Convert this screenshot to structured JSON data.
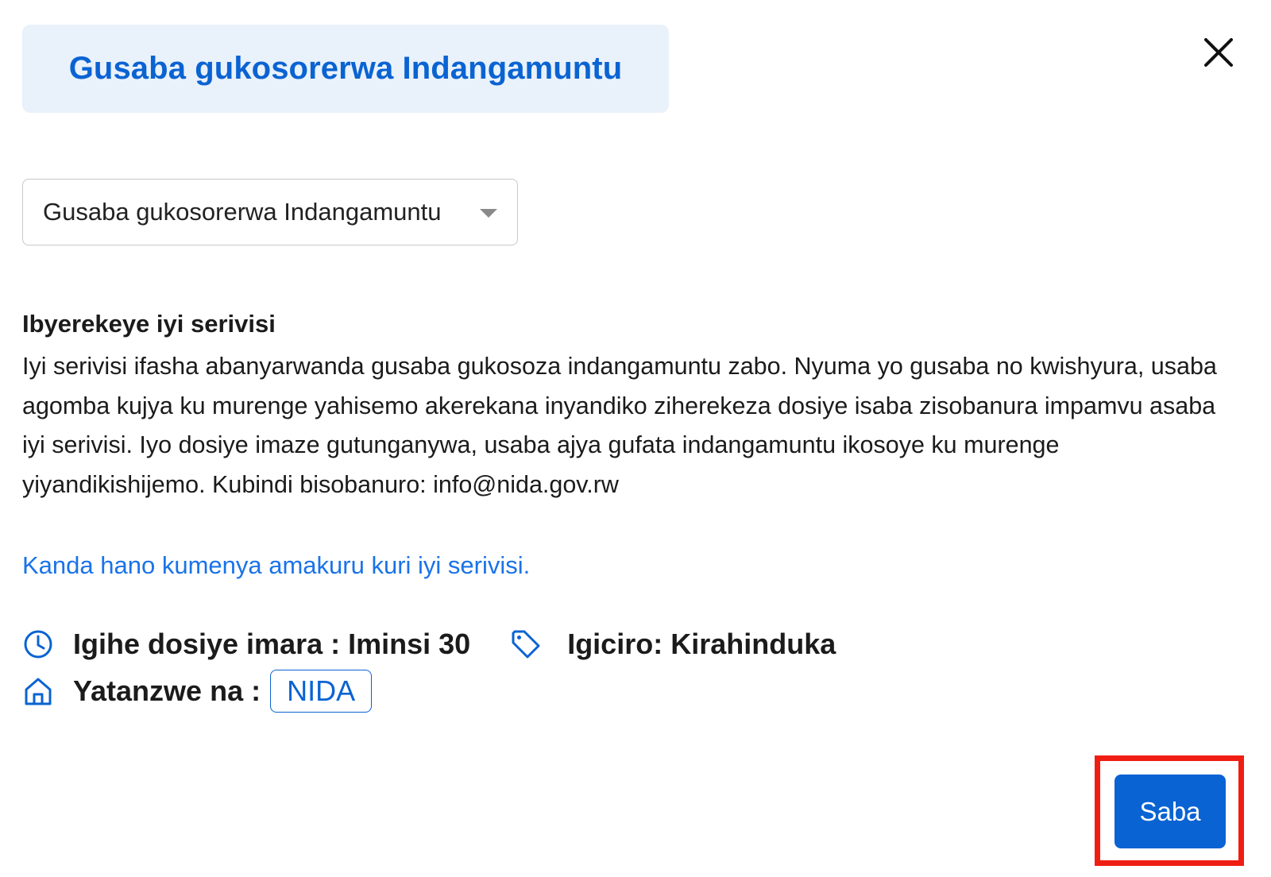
{
  "header": {
    "title": "Gusaba gukosorerwa Indangamuntu",
    "close_icon": "close-icon"
  },
  "service_select": {
    "selected_value": "Gusaba gukosorerwa Indangamuntu",
    "caret_icon": "caret-down-icon"
  },
  "about": {
    "heading": "Ibyerekeye iyi serivisi",
    "body": "Iyi serivisi ifasha abanyarwanda gusaba gukosoza indangamuntu zabo. Nyuma yo gusaba no kwishyura, usaba agomba kujya ku murenge yahisemo akerekana inyandiko ziherekeza dosiye isaba zisobanura impamvu asaba iyi serivisi. Iyo dosiye imaze gutunganywa, usaba ajya gufata indangamuntu ikosoye ku murenge yiyandikishijemo. Kubindi bisobanuro: info@nida.gov.rw"
  },
  "more_info_link": "Kanda hano kumenya amakuru kuri iyi serivisi.",
  "meta": {
    "duration_icon": "clock-icon",
    "duration_text": "Igihe dosiye imara : Iminsi 30",
    "price_icon": "price-tag-icon",
    "price_text": "Igiciro: Kirahinduka",
    "provider_icon": "home-icon",
    "provider_label": "Yatanzwe na :",
    "provider_name": "NIDA"
  },
  "actions": {
    "apply_label": "Saba"
  },
  "colors": {
    "brand_blue": "#0a63d2",
    "link_blue": "#1a73e8",
    "title_bg": "#e9f1fb",
    "highlight_red": "#f01d12"
  }
}
